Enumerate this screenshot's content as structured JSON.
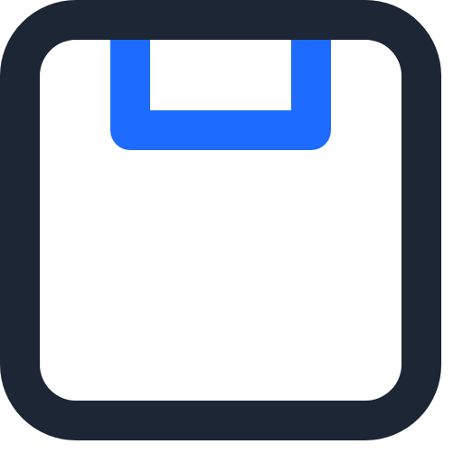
{
  "icon": {
    "name": "save-icon",
    "stroke_color": "#1C2635",
    "accent_color": "#1E6CFF",
    "background_color": "#FFFFFF"
  }
}
